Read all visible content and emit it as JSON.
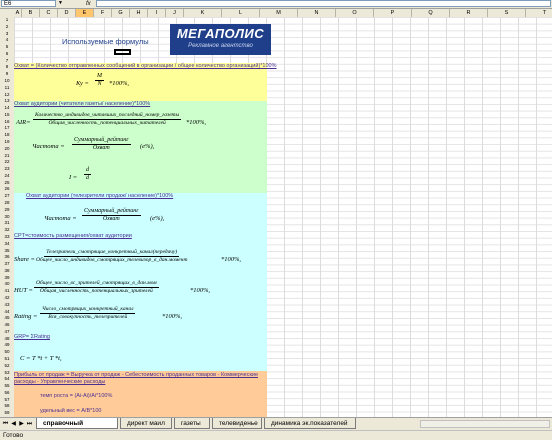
{
  "formula_bar": {
    "name_box": "E6",
    "fx_label": "fx",
    "formula": ""
  },
  "columns": [
    "A",
    "B",
    "C",
    "D",
    "E",
    "F",
    "G",
    "H",
    "I",
    "J",
    "K",
    "L",
    "M",
    "N",
    "O",
    "P",
    "Q",
    "R",
    "S",
    "T",
    "U"
  ],
  "active_column": "E",
  "rows": [
    "1",
    "2",
    "3",
    "4",
    "5",
    "6",
    "7",
    "8",
    "9",
    "10",
    "11",
    "12",
    "13",
    "14",
    "15",
    "16",
    "17",
    "18",
    "19",
    "20",
    "21",
    "22",
    "23",
    "24",
    "25",
    "26",
    "27",
    "28",
    "29",
    "30",
    "31",
    "32",
    "33",
    "34",
    "35",
    "36",
    "37",
    "38",
    "39",
    "40",
    "41",
    "42",
    "43",
    "44",
    "45",
    "46",
    "47",
    "48",
    "49",
    "50",
    "51",
    "52",
    "53",
    "54",
    "55",
    "56",
    "57",
    "58",
    "59"
  ],
  "sheet": {
    "title": "Используемые формулы",
    "logo_main": "МЕГАПОЛИС",
    "logo_sub": "Рекламное агентство",
    "section1_heading": "Охват = (Количество отправленных сообщений в организации / общее количество организаций)*100%",
    "formula_ky": "Ку = M/N *100%,",
    "ky_lhs": "Ку =",
    "ky_num": "M",
    "ky_den": "N",
    "ky_tail": "*100%,",
    "section2_heading": "Охват аудитории (читатели газеты/ население)*100%",
    "air_lhs": "AIR=",
    "air_num": "Количество_индивидов_читавших_последний_номер_газеты",
    "air_den": "Общая_численность_потенциальных_читателей",
    "air_tail": "*100%,",
    "freq_lhs": "Частота =",
    "freq_num": "Суммарный_рейтинг",
    "freq_den": "Охват",
    "freq_tail": "(е%),",
    "icov_lhs": "I =",
    "icov_num": "d",
    "icov_den": "d",
    "section3_heading": "Охват аудитории (телезрители продаж/ население)*100%",
    "freq2_lhs": "Частота =",
    "freq2_num": "Суммарный_рейтинг",
    "freq2_den": "Охват",
    "freq2_tail": "(е%),",
    "cpt_heading": "CPT=стоимость размещения/охват аудитории",
    "share_lhs": "Share =",
    "share_num": "Телезрители_смотрящие_конкретный_канал(передачу)",
    "share_den": "Общее_число_индивидов_смотрящих_телевизор_в_дан.момент",
    "share_tail": "*100%,",
    "hut_lhs": "HUT =",
    "hut_num": "Общее_число_вс_зрителей_смотрящих_в_дан.мом",
    "hut_den": "Общая_численность_потенциальных_зрителей",
    "hut_tail": "*100%,",
    "rating_lhs": "Rating =",
    "rating_num": "Число_смотрящих_конкретный_канал",
    "rating_den": "Вся_совокупность_телезрителей",
    "rating_tail": "*100%,",
    "grp_heading": "GRP= ΣRating",
    "ct_formula": "C = T *t + T *t,",
    "profit_heading": "Прибыль от продаж = Выручка от продаж - Себестоимость проданных товаров - Коммерческие расходы - Управленческие расходы",
    "growth_rate": "темп роста = (Ai-Ai)/Ai*100%",
    "share_weight": "удельный вес = A/B*100"
  },
  "tabs": [
    "справочный материал",
    "директ маил",
    "газеты",
    "телевиденье",
    "динамика эк.показателей"
  ],
  "active_tab": "справочный материал",
  "status": "Готово",
  "colors": {
    "yellow_block": "#ffff99",
    "green_block": "#ccffcc",
    "cyan_block": "#ccffff",
    "orange_block": "#ffcc99",
    "heading_text": "#4b2f93",
    "logo_bg": "#1f3f8a"
  }
}
